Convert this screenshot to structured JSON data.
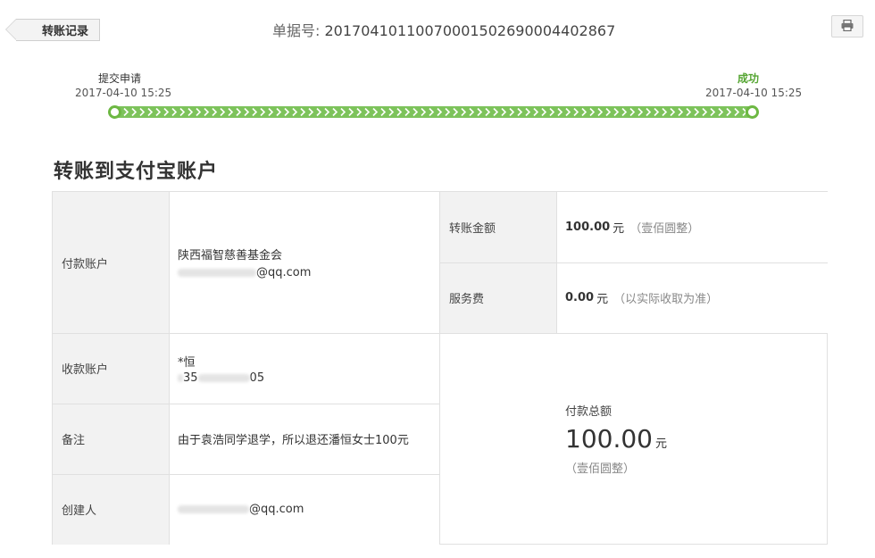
{
  "header": {
    "back_label": "转账记录",
    "order_label": "单据号:",
    "order_number": "20170410110070001502690004402867",
    "print_icon": "printer-icon"
  },
  "progress": {
    "start": {
      "label": "提交申请",
      "time": "2017-04-10 15:25"
    },
    "end": {
      "label": "成功",
      "time": "2017-04-10 15:25"
    },
    "colors": {
      "track": "#7dc35b",
      "node": "#6db843",
      "success_text": "#55a532"
    }
  },
  "section_title": "转账到支付宝账户",
  "details": {
    "payer": {
      "label": "付款账户",
      "name": "陕西福智慈善基金会",
      "email_suffix": "@qq.com"
    },
    "payee": {
      "label": "收款账户",
      "name": "*恒",
      "phone_prefix": "1",
      "phone_mid": "35",
      "phone_suffix": "05"
    },
    "note": {
      "label": "备注",
      "value": "由于袁浩同学退学，所以退还潘恒女士100元"
    },
    "creator": {
      "label": "创建人",
      "email_suffix": "@qq.com"
    },
    "amount": {
      "label": "转账金额",
      "value": "100.00",
      "unit": "元",
      "upper": "（壹佰圆整）"
    },
    "fee": {
      "label": "服务费",
      "value": "0.00",
      "unit": "元",
      "note": "（以实际收取为准）"
    },
    "total": {
      "label": "付款总额",
      "value": "100.00",
      "unit": "元",
      "upper": "（壹佰圆整）"
    }
  }
}
